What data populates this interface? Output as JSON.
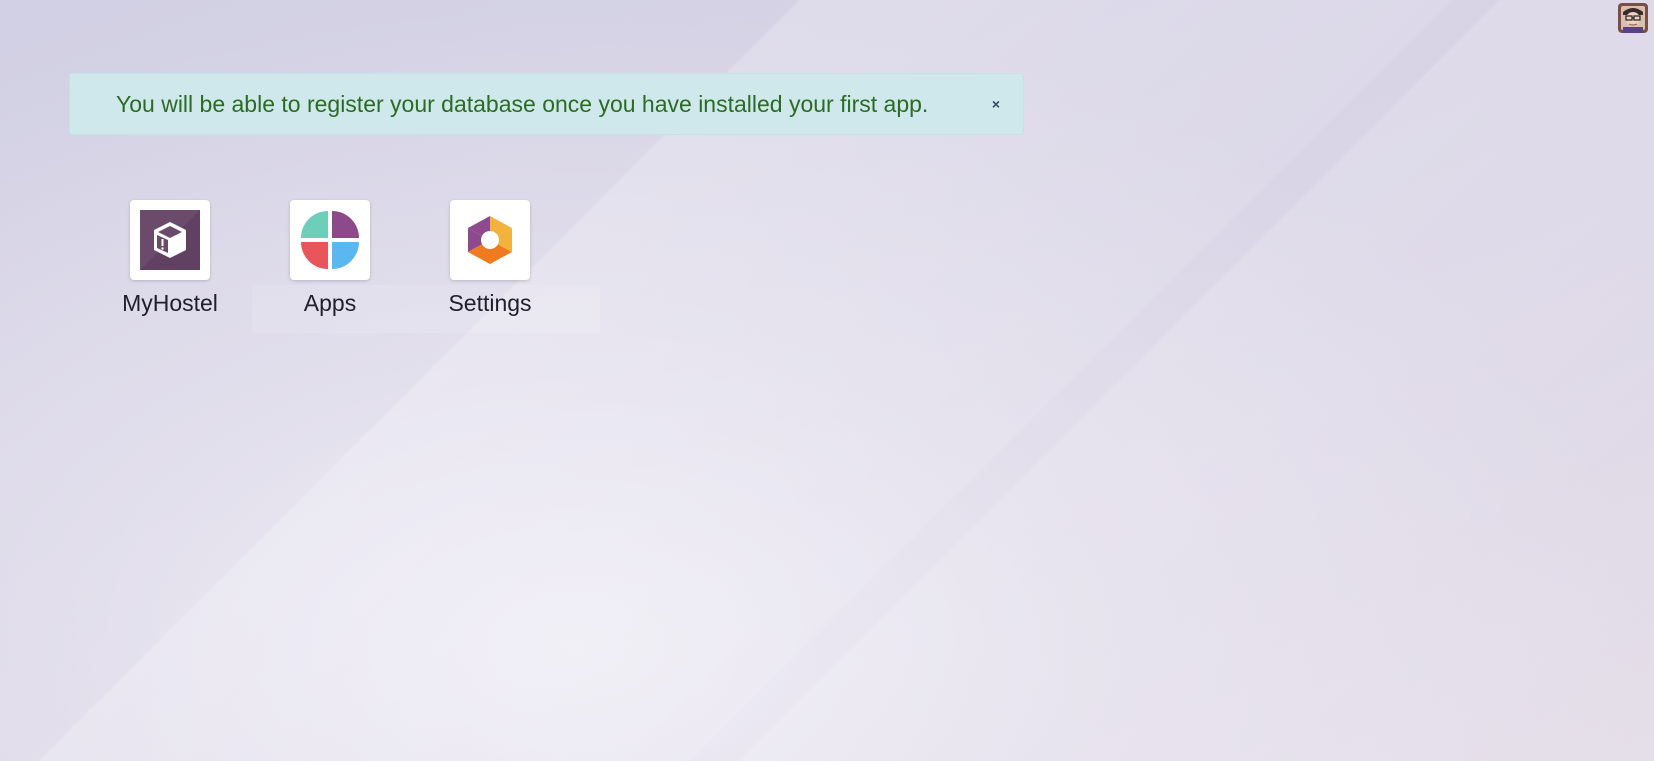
{
  "alert": {
    "message": "You will be able to register your database once you have installed your first app.",
    "close_glyph": "×"
  },
  "user": {
    "avatar_icon": "user-avatar-icon"
  },
  "apps": [
    {
      "label": "MyHostel",
      "icon": "box-icon"
    },
    {
      "label": "Apps",
      "icon": "apps-icon"
    },
    {
      "label": "Settings",
      "icon": "settings-icon"
    }
  ],
  "colors": {
    "alert_bg": "#cfe8ec",
    "alert_text": "#2c6b25",
    "myhostel_icon_bg": "#6b4a6b",
    "apps_teal": "#6dcfb9",
    "apps_purple": "#8c4a8a",
    "apps_red": "#e8565b",
    "apps_blue": "#5bb7f0",
    "settings_purple": "#8d4a8d",
    "settings_orange": "#f07a1f",
    "settings_yellow": "#f2b33c"
  }
}
